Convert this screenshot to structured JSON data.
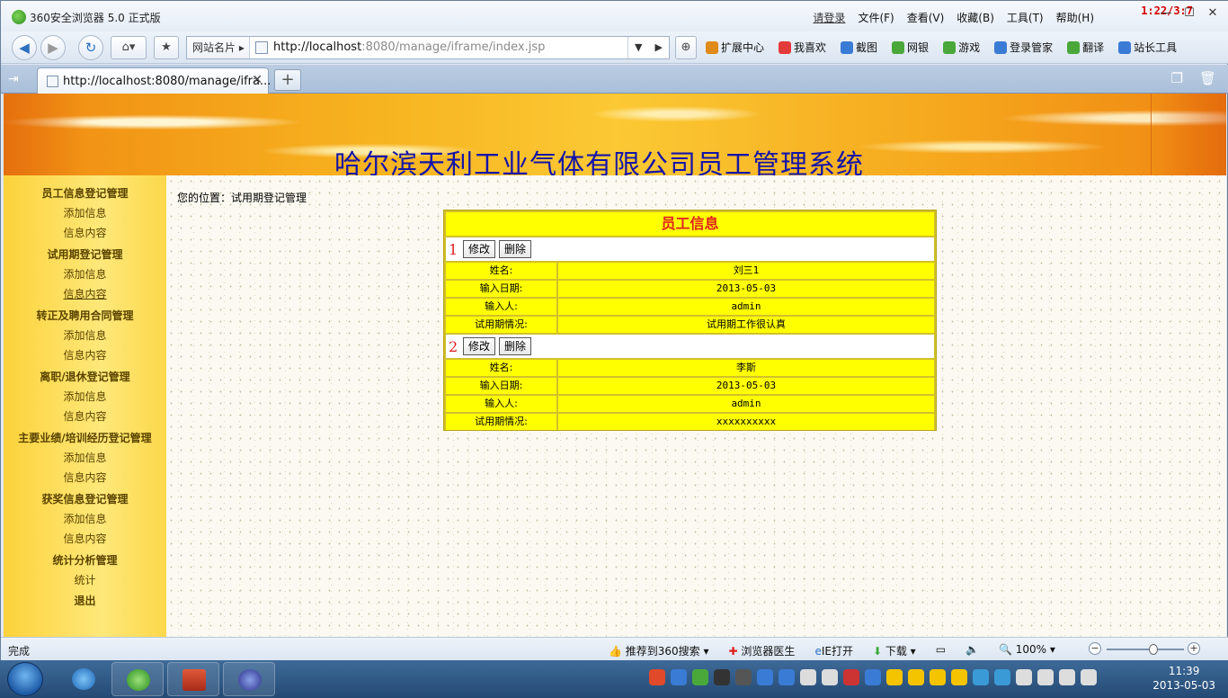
{
  "browser": {
    "app_title": "360安全浏览器 5.0 正式版",
    "login_label": "请登录",
    "menus": [
      "文件(F)",
      "查看(V)",
      "收藏(B)",
      "工具(T)",
      "帮助(H)"
    ],
    "timer": "1:22/3:7",
    "window_controls": [
      "—",
      "☐",
      "✕"
    ]
  },
  "navbar": {
    "favs_label": "网站名片",
    "url_base": "http://localhost",
    "url_rest": ":8080/manage/iframe/index.jsp",
    "toolbar": [
      {
        "label": "扩展中心",
        "color": "#e08a1a"
      },
      {
        "label": "我喜欢",
        "color": "#e33a3a"
      },
      {
        "label": "截图",
        "color": "#3a7bd5"
      },
      {
        "label": "网银",
        "color": "#4aa83a"
      },
      {
        "label": "游戏",
        "color": "#4aa83a"
      },
      {
        "label": "登录管家",
        "color": "#3a7bd5"
      },
      {
        "label": "翻译",
        "color": "#4aa83a"
      },
      {
        "label": "站长工具",
        "color": "#3a7bd5"
      }
    ]
  },
  "tabs": {
    "active_tab": "http://localhost:8080/manage/ifra...",
    "close_glyph": "✕",
    "new_tab_glyph": "+"
  },
  "page": {
    "banner_title": "哈尔滨天利工业气体有限公司员工管理系统",
    "breadcrumb": "您的位置：试用期登记管理",
    "sidebar": [
      {
        "heading": "员工信息登记管理",
        "items": [
          "添加信息",
          "信息内容"
        ]
      },
      {
        "heading": "试用期登记管理",
        "items": [
          "添加信息",
          "信息内容"
        ]
      },
      {
        "heading": "转正及聘用合同管理",
        "items": [
          "添加信息",
          "信息内容"
        ]
      },
      {
        "heading": "离职/退休登记管理",
        "items": [
          "添加信息",
          "信息内容"
        ]
      },
      {
        "heading": "主要业绩/培训经历登记管理",
        "items": [
          "添加信息",
          "信息内容"
        ]
      },
      {
        "heading": "获奖信息登记管理",
        "items": [
          "添加信息",
          "信息内容"
        ]
      },
      {
        "heading": "统计分析管理",
        "items": [
          "统计"
        ]
      }
    ],
    "logout": "退出",
    "panel": {
      "title": "员工信息",
      "edit_label": "修改",
      "delete_label": "删除",
      "field_labels": [
        "姓名:",
        "输入日期:",
        "输入人:",
        "试用期情况:"
      ],
      "records": [
        {
          "num": "1",
          "values": [
            "刘三1",
            "2013-05-03",
            "admin",
            "试用期工作很认真"
          ]
        },
        {
          "num": "2",
          "values": [
            "李斯",
            "2013-05-03",
            "admin",
            "xxxxxxxxxx"
          ]
        }
      ]
    }
  },
  "statusbar": {
    "status": "完成",
    "items": [
      "推荐到360搜索",
      "浏览器医生",
      "IE打开",
      "下载"
    ],
    "zoom": "100%",
    "zoom_level": 0.6
  },
  "taskbar": {
    "time": "11:39",
    "date": "2013-05-03"
  }
}
